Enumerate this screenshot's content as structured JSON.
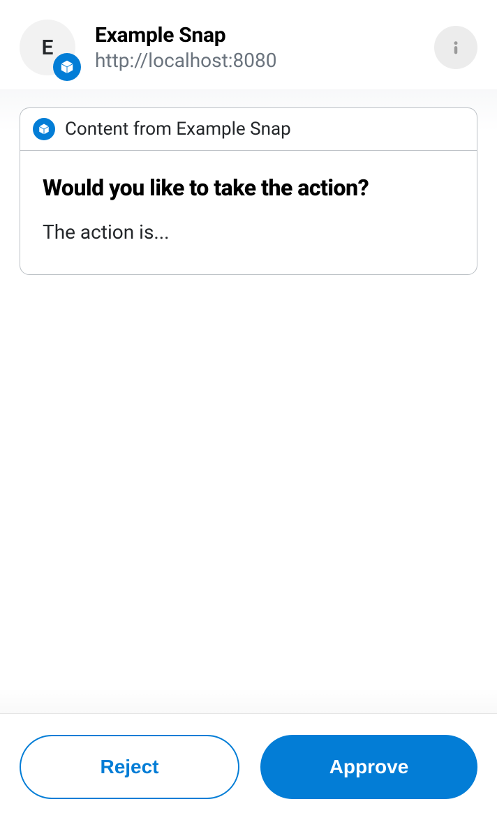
{
  "header": {
    "avatar_letter": "E",
    "title": "Example Snap",
    "subtitle": "http://localhost:8080"
  },
  "card": {
    "source_label": "Content from Example Snap",
    "title": "Would you like to take the action?",
    "description": "The action is..."
  },
  "footer": {
    "reject_label": "Reject",
    "approve_label": "Approve"
  }
}
